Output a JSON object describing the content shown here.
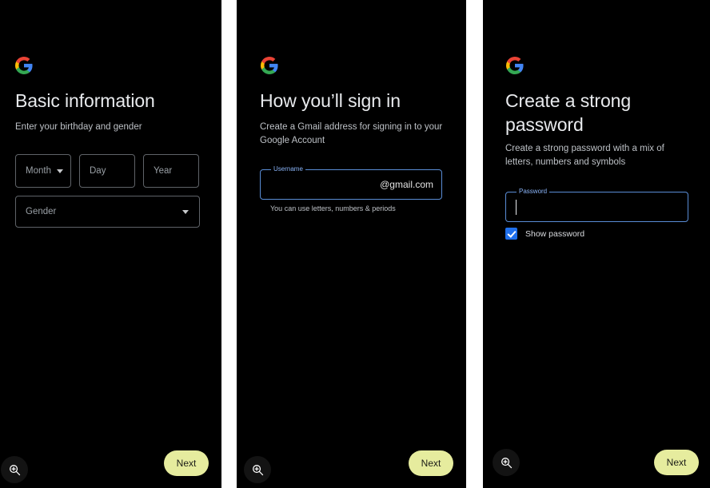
{
  "theme": {
    "background": "#000000",
    "gap_color": "#ffffff",
    "title_color": "#e8eaed",
    "subtitle_color": "#bdc1c6",
    "outline_color": "#5f6368",
    "focus_outline_color": "#5a8dd6",
    "focus_label_color": "#8ab4f8",
    "checkbox_color": "#1f6feb",
    "next_button_bg": "#e6ec9e",
    "next_button_text": "#1b1c17"
  },
  "panels": [
    {
      "id": "basic-information",
      "logo": "google-g-icon",
      "title": "Basic information",
      "subtitle": "Enter your birthday and gender",
      "fields": {
        "month": {
          "label": "Month",
          "value": "",
          "icon": "chevron-down-icon"
        },
        "day": {
          "label": "Day",
          "value": ""
        },
        "year": {
          "label": "Year",
          "value": ""
        },
        "gender": {
          "label": "Gender",
          "value": "",
          "icon": "chevron-down-icon"
        }
      },
      "zoom_icon": "magnifier-plus-icon",
      "next_label": "Next"
    },
    {
      "id": "how-youll-sign-in",
      "logo": "google-g-icon",
      "title": "How you’ll sign in",
      "subtitle": "Create a Gmail address for signing in to your Google Account",
      "fields": {
        "username": {
          "label": "Username",
          "value": "",
          "suffix": "@gmail.com",
          "helper": "You can use letters, numbers & periods",
          "focused": true
        }
      },
      "zoom_icon": "magnifier-plus-icon",
      "next_label": "Next"
    },
    {
      "id": "create-a-strong-password",
      "logo": "google-g-icon",
      "title": "Create a strong password",
      "subtitle": "Create a strong password with a mix of letters, numbers and symbols",
      "fields": {
        "password": {
          "label": "Password",
          "value": "",
          "focused": true
        }
      },
      "checkbox": {
        "label": "Show password",
        "checked": true
      },
      "zoom_icon": "magnifier-plus-icon",
      "next_label": "Next"
    }
  ]
}
